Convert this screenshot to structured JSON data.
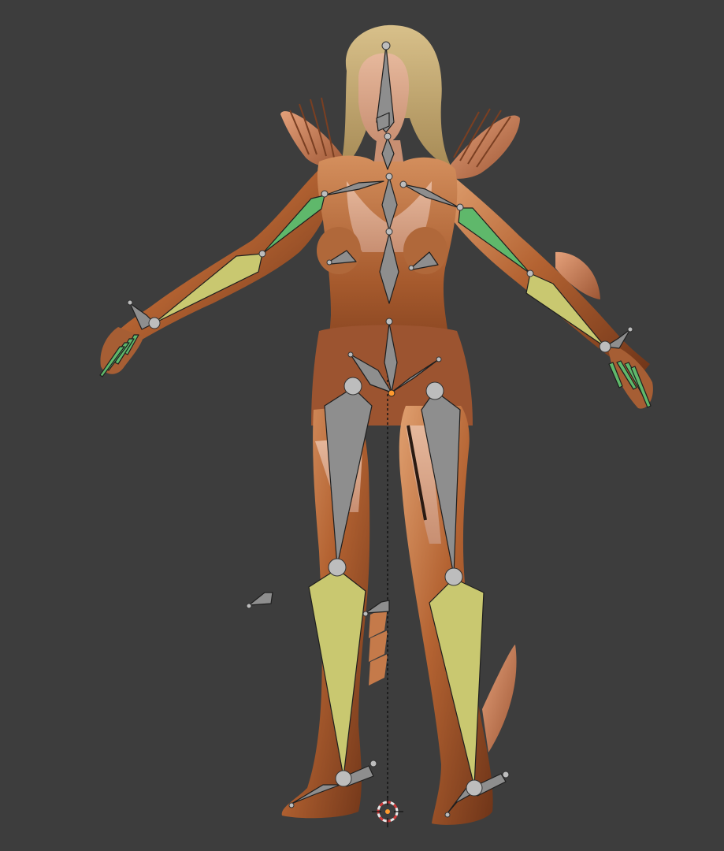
{
  "viewport": {
    "background": "#3d3d3d",
    "object_color": "#b86a3a",
    "skin_color": "#d9a58a",
    "hair_color": "#c9b07a",
    "bone_default": "#8e8e8e",
    "bone_selected": "#c9c870",
    "bone_ik": "#5fb86b",
    "cursor_icon": "3d-cursor-icon",
    "origin_icon": "object-origin-icon"
  }
}
